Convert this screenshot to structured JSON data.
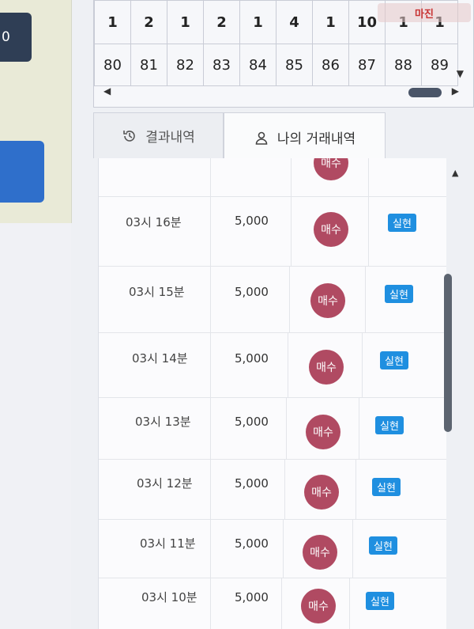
{
  "left_panel": {
    "button_text": "0"
  },
  "grid": {
    "counts": [
      "1",
      "2",
      "1",
      "2",
      "1",
      "4",
      "1",
      "10",
      "1",
      "1"
    ],
    "numbers": [
      "80",
      "81",
      "82",
      "83",
      "84",
      "85",
      "86",
      "87",
      "88",
      "89"
    ]
  },
  "tabs": {
    "results_label": "결과내역",
    "my_trades_label": "나의 거래내역"
  },
  "watermark": "마진",
  "trades": [
    {
      "time": "",
      "amount": "",
      "action": "매수",
      "result": ""
    },
    {
      "time": "03시 16분",
      "amount": "5,000",
      "action": "매수",
      "result": "실현"
    },
    {
      "time": "03시 15분",
      "amount": "5,000",
      "action": "매수",
      "result": "실현"
    },
    {
      "time": "03시 14분",
      "amount": "5,000",
      "action": "매수",
      "result": "실현"
    },
    {
      "time": "03시 13분",
      "amount": "5,000",
      "action": "매수",
      "result": "실현"
    },
    {
      "time": "03시 12분",
      "amount": "5,000",
      "action": "매수",
      "result": "실현"
    },
    {
      "time": "03시 11분",
      "amount": "5,000",
      "action": "매수",
      "result": "실현"
    },
    {
      "time": "03시 10분",
      "amount": "5,000",
      "action": "매수",
      "result": "실현"
    }
  ],
  "colors": {
    "buy_badge": "#b04a62",
    "realized_badge": "#1f8fe0",
    "left_button": "#2f3e55",
    "left_blue": "#2f6fcb"
  },
  "icons": {
    "results_tab": "history-icon",
    "my_trades_tab": "user-icon"
  }
}
